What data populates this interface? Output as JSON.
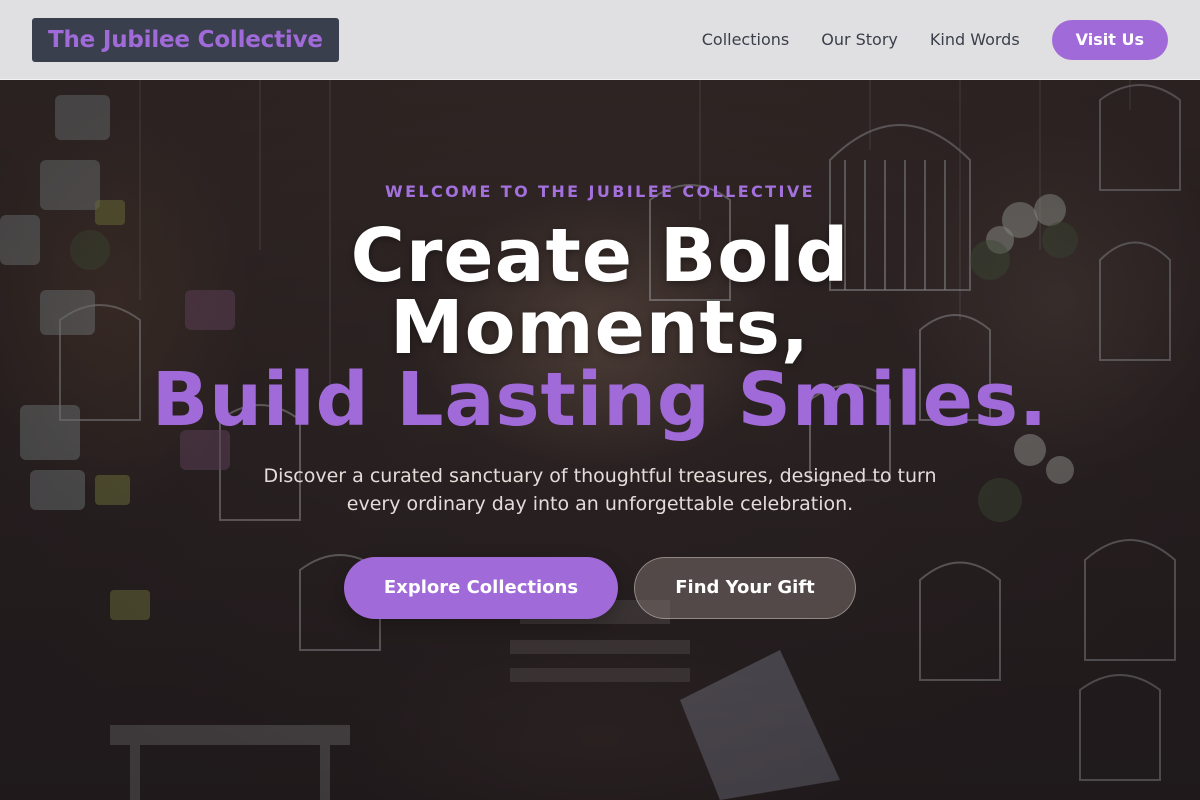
{
  "nav": {
    "brand": "The Jubilee Collective",
    "links": [
      "Collections",
      "Our Story",
      "Kind Words"
    ],
    "cta": "Visit Us"
  },
  "hero": {
    "eyebrow": "WELCOME TO THE JUBILEE COLLECTIVE",
    "headline_line1": "Create Bold",
    "headline_line2": "Moments,",
    "headline_line3": "Build Lasting Smiles.",
    "subtext": "Discover a curated sanctuary of thoughtful treasures, designed to turn every ordinary day into an unforgettable celebration.",
    "primary_button": "Explore Collections",
    "secondary_button": "Find Your Gift",
    "background_image": "hanging-birdcages-and-teacups-shop-photo"
  },
  "colors": {
    "accent": "#a16ad9",
    "brand_bg": "#3a3f4e",
    "nav_bg": "#ececee",
    "nav_text": "#3b3f4a",
    "headline_white": "#ffffff",
    "subtext": "#e3dcd8"
  }
}
